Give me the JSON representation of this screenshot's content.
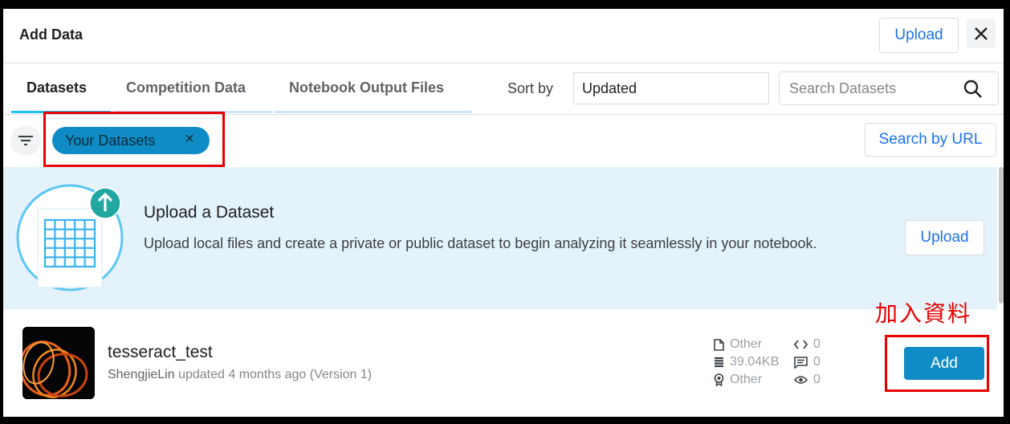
{
  "dialog": {
    "title": "Add Data",
    "upload_label": "Upload"
  },
  "tabs": [
    {
      "label": "Datasets",
      "active": true
    },
    {
      "label": "Competition Data",
      "active": false
    },
    {
      "label": "Notebook Output Files",
      "active": false
    }
  ],
  "sort": {
    "label": "Sort by",
    "value": "Updated"
  },
  "search": {
    "placeholder": "Search Datasets"
  },
  "filter": {
    "chip_label": "Your Datasets",
    "search_by_url_label": "Search by URL"
  },
  "banner": {
    "title": "Upload a Dataset",
    "description": "Upload local files and create a private or public dataset to begin analyzing it seamlessly in your notebook.",
    "upload_label": "Upload"
  },
  "dataset": {
    "name": "tesseract_test",
    "owner": "ShengjieLin",
    "updated": "updated 4 months ago (Version 1)",
    "file_type": "Other",
    "size": "39.04KB",
    "license": "Other",
    "code_count": "0",
    "discussion_count": "0",
    "view_count": "0",
    "add_label": "Add"
  },
  "annotation": "加入資料",
  "colors": {
    "accent": "#0f8cc5",
    "highlight": "#e60000",
    "banner_bg": "#e3f2fb"
  },
  "icons": [
    "close-icon",
    "search-icon",
    "filter-icon",
    "upload-arrow-icon",
    "spreadsheet-icon",
    "file-icon",
    "code-icon",
    "database-icon",
    "discussion-icon",
    "license-icon",
    "eye-icon"
  ]
}
